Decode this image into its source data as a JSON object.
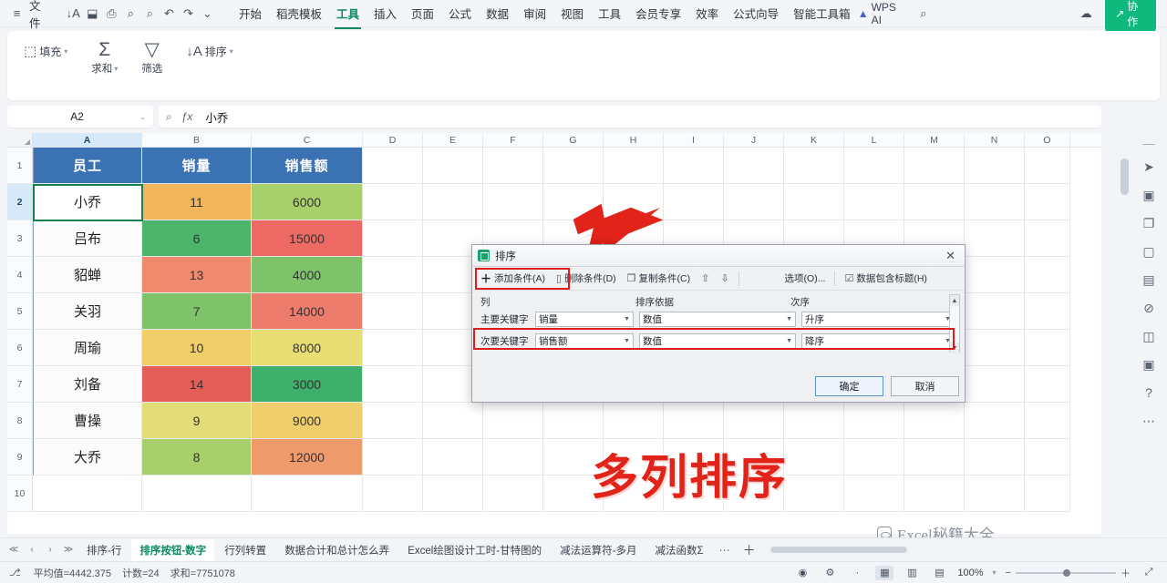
{
  "topbar": {
    "menu_glyph": "≡",
    "file_label": "文件",
    "icons": [
      {
        "name": "sort-az-icon",
        "glyph": "↓A"
      },
      {
        "name": "save-icon",
        "glyph": "⬓"
      },
      {
        "name": "print-icon",
        "glyph": "⎙"
      },
      {
        "name": "print-preview-icon",
        "glyph": "⌕"
      },
      {
        "name": "find-icon",
        "glyph": "⌕"
      },
      {
        "name": "undo-icon",
        "glyph": "↶"
      },
      {
        "name": "redo-icon",
        "glyph": "↷"
      },
      {
        "name": "more-icon",
        "glyph": "⌄"
      }
    ],
    "menus": [
      {
        "label": "开始",
        "active": false
      },
      {
        "label": "稻壳模板",
        "active": false
      },
      {
        "label": "工具",
        "active": true
      },
      {
        "label": "插入",
        "active": false
      },
      {
        "label": "页面",
        "active": false
      },
      {
        "label": "公式",
        "active": false
      },
      {
        "label": "数据",
        "active": false
      },
      {
        "label": "审阅",
        "active": false
      },
      {
        "label": "视图",
        "active": false
      },
      {
        "label": "工具",
        "active": false
      },
      {
        "label": "会员专享",
        "active": false
      },
      {
        "label": "效率",
        "active": false
      },
      {
        "label": "公式向导",
        "active": false
      },
      {
        "label": "智能工具箱",
        "active": false
      }
    ],
    "wps_ai_label": "WPS AI",
    "search_glyph": "⌕",
    "cloud_glyph": "☁",
    "collab_label": "协作",
    "collab_color": "#0fb97d"
  },
  "ribbon": {
    "groups": [
      {
        "name": "fill",
        "glyph": "⬚",
        "label": "填充",
        "caret": "▾",
        "stacked": false
      },
      {
        "name": "sum",
        "glyph": "Σ",
        "label": "求和",
        "caret": "▾",
        "stacked": true
      },
      {
        "name": "filter",
        "glyph": "▽",
        "label": "筛选",
        "caret": "",
        "stacked": true
      },
      {
        "name": "sort",
        "glyph": "↓A",
        "label": "排序",
        "caret": "▾",
        "stacked": false
      }
    ]
  },
  "formulabar": {
    "namebox_value": "A2",
    "namebox_caret": "⌄",
    "insert_fn_glyph": "ƒx",
    "search_glyph": "⌕",
    "formula_value": "小乔"
  },
  "sheet": {
    "columns": [
      "A",
      "B",
      "C",
      "D",
      "E",
      "F",
      "G",
      "H",
      "I",
      "J",
      "K",
      "L",
      "M",
      "N",
      "O"
    ],
    "selected_column": "A",
    "rows": [
      "1",
      "2",
      "3",
      "4",
      "5",
      "6",
      "7",
      "8",
      "9",
      "10"
    ],
    "selected_row": "2",
    "header": [
      "员工",
      "销量",
      "销售额"
    ],
    "header_bg": "#3a72b4",
    "data": [
      {
        "name": "小乔",
        "qty": "11",
        "amount": "6000",
        "qty_bg": "#f2b55c",
        "amount_bg": "#a8d06a"
      },
      {
        "name": "吕布",
        "qty": "6",
        "amount": "15000",
        "qty_bg": "#4cb56b",
        "amount_bg": "#ec6a63"
      },
      {
        "name": "貂蝉",
        "qty": "13",
        "amount": "4000",
        "qty_bg": "#f08a6e",
        "amount_bg": "#7ec36a"
      },
      {
        "name": "关羽",
        "qty": "7",
        "amount": "14000",
        "qty_bg": "#7ec36a",
        "amount_bg": "#ee7c6c"
      },
      {
        "name": "周瑜",
        "qty": "10",
        "amount": "8000",
        "qty_bg": "#f0cf6a",
        "amount_bg": "#e8dd72"
      },
      {
        "name": "刘备",
        "qty": "14",
        "amount": "3000",
        "qty_bg": "#e35d59",
        "amount_bg": "#3fb06b"
      },
      {
        "name": "曹操",
        "qty": "9",
        "amount": "9000",
        "qty_bg": "#e2dd78",
        "amount_bg": "#f0ce6b"
      },
      {
        "name": "大乔",
        "qty": "8",
        "amount": "12000",
        "qty_bg": "#a9ce6c",
        "amount_bg": "#ef9a6b"
      }
    ]
  },
  "rail": {
    "buttons": [
      {
        "name": "cursor-select-icon",
        "glyph": "➤"
      },
      {
        "name": "image-icon",
        "glyph": "Ὓc"
      },
      {
        "name": "layers-icon",
        "glyph": "❐"
      },
      {
        "name": "shapes-icon",
        "glyph": "▢"
      },
      {
        "name": "table-style-icon",
        "glyph": "▤"
      },
      {
        "name": "no-entry-icon",
        "glyph": "⊘"
      },
      {
        "name": "chart-icon",
        "glyph": "◫"
      },
      {
        "name": "cell-format-icon",
        "glyph": "▣"
      },
      {
        "name": "help-icon",
        "glyph": "?"
      },
      {
        "name": "more-icon",
        "glyph": "⋯"
      }
    ]
  },
  "dialog": {
    "title": "排序",
    "close_glyph": "✕",
    "toolbar": [
      {
        "name": "add-condition-button",
        "glyph": "＋",
        "label": "添加条件(A)",
        "disabled": false,
        "highlighted": true
      },
      {
        "name": "delete-condition-button",
        "glyph": "⊖",
        "label": "删除条件(D)",
        "disabled": false,
        "highlighted": false
      },
      {
        "name": "copy-condition-button",
        "glyph": "❐",
        "label": "复制条件(C)",
        "disabled": false,
        "highlighted": false
      },
      {
        "name": "move-up-button",
        "glyph": "⇧",
        "label": "",
        "disabled": false,
        "highlighted": false
      },
      {
        "name": "move-down-button",
        "glyph": "⇩",
        "label": "",
        "disabled": true,
        "highlighted": false
      },
      {
        "name": "options-button",
        "glyph": "",
        "label": "选项(O)...",
        "disabled": false,
        "highlighted": false
      },
      {
        "name": "has-header-checkbox",
        "glyph": "☑",
        "label": "数据包含标题(H)",
        "disabled": false,
        "highlighted": false
      }
    ],
    "list_headers": {
      "col": "列",
      "basis": "排序依据",
      "order": "次序"
    },
    "conditions": [
      {
        "label": "主要关键字",
        "column": "销量",
        "basis": "数值",
        "order": "升序",
        "highlighted": false
      },
      {
        "label": "次要关键字",
        "column": "销售额",
        "basis": "数值",
        "order": "降序",
        "highlighted": true
      }
    ],
    "ok_label": "确定",
    "cancel_label": "取消",
    "highlight_color": "#e01b1b"
  },
  "annotations": {
    "arrow_color": "#e2231a",
    "big_text": "多列排序",
    "big_text_color": "#e2231a",
    "watermark": "Excel秘籍大全"
  },
  "tabbar": {
    "nav": [
      "≪",
      "‹",
      "›",
      "≫"
    ],
    "tabs": [
      {
        "label": "排序-行",
        "active": false
      },
      {
        "label": "排序按钮-数字",
        "active": true
      },
      {
        "label": "行列转置",
        "active": false
      },
      {
        "label": "数据合计和总计怎么弄",
        "active": false
      },
      {
        "label": "Excel绘图设计工时-甘特图的",
        "active": false
      },
      {
        "label": "减法运算符-多月",
        "active": false
      },
      {
        "label": "减法函数Σ",
        "active": false
      }
    ],
    "more_glyph": "⋯",
    "plus_glyph": "＋"
  },
  "statusbar": {
    "record_glyph": "⎇",
    "stats": [
      "平均值=4442.375",
      "计数=24",
      "求和=7751078"
    ],
    "right_icons": [
      {
        "name": "eye-icon",
        "glyph": "◉"
      },
      {
        "name": "accessibility-icon",
        "glyph": "⚙"
      },
      {
        "name": "dot-icon",
        "glyph": "·"
      }
    ],
    "view_buttons": [
      {
        "name": "normal-view-button",
        "glyph": "▦",
        "active": true
      },
      {
        "name": "page-layout-button",
        "glyph": "▥",
        "active": false
      },
      {
        "name": "page-break-button",
        "glyph": "▤",
        "active": false
      }
    ],
    "zoom_label": "100%",
    "zoom_caret": "▾",
    "minus_glyph": "−",
    "plus_glyph": "＋",
    "fullscreen_glyph": "⤢"
  }
}
